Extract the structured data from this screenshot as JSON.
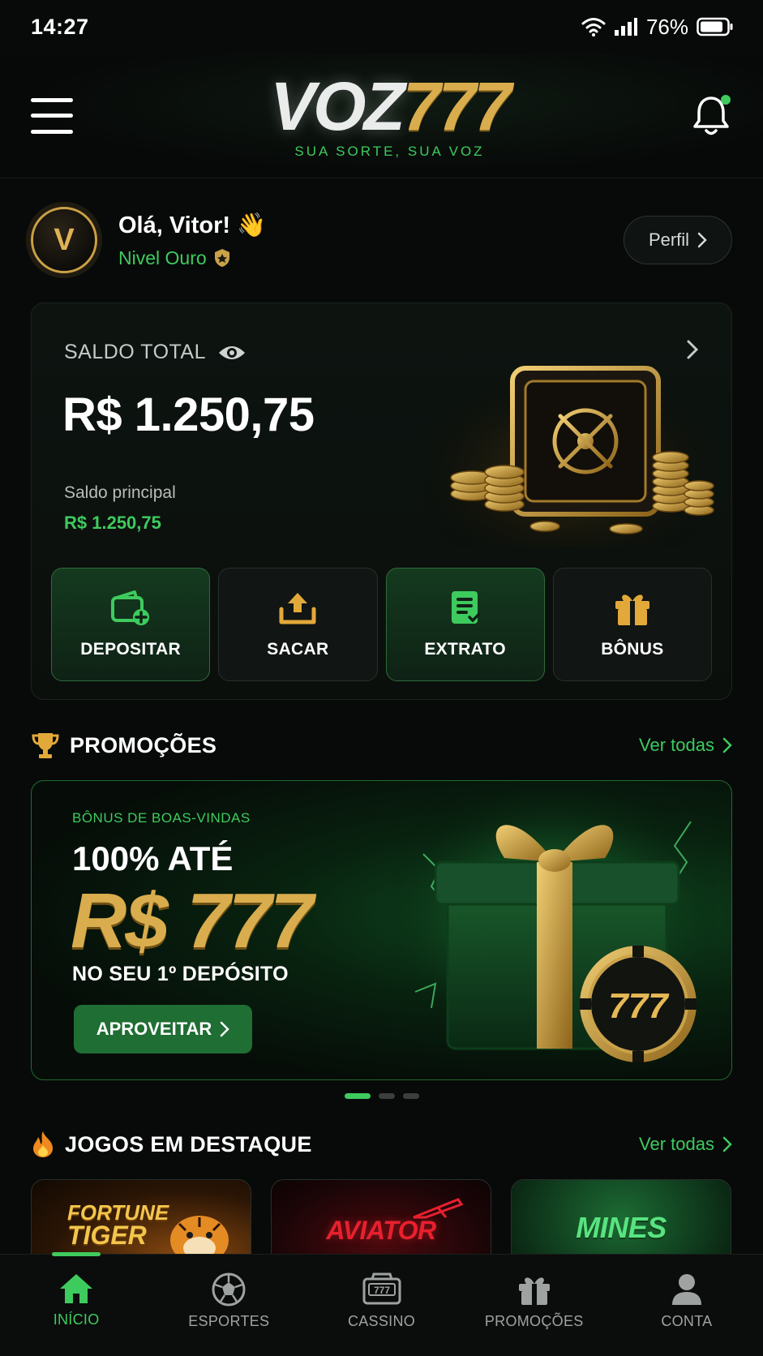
{
  "status_bar": {
    "time": "14:27",
    "battery": "76%"
  },
  "header": {
    "logo_left": "VOZ",
    "logo_right": "777",
    "tagline": "SUA SORTE, SUA VOZ"
  },
  "greeting": {
    "initial": "V",
    "hello": "Olá, Vitor! 👋",
    "level": "Nivel Ouro",
    "profile_button": "Perfil"
  },
  "balance": {
    "label": "SALDO TOTAL",
    "value": "R$ 1.250,75",
    "main_label": "Saldo principal",
    "main_value": "R$ 1.250,75",
    "actions": [
      {
        "label": "DEPOSITAR",
        "icon": "wallet-plus-icon"
      },
      {
        "label": "SACAR",
        "icon": "upload-tray-icon"
      },
      {
        "label": "EXTRATO",
        "icon": "receipt-icon"
      },
      {
        "label": "BÔNUS",
        "icon": "gift-icon"
      }
    ]
  },
  "promotions": {
    "title": "PROMOÇÕES",
    "see_all": "Ver todas",
    "banner": {
      "kicker": "BÔNUS DE BOAS-VINDAS",
      "line1": "100% ATÉ",
      "amount": "R$ 777",
      "line2": "NO SEU 1º DEPÓSITO",
      "cta": "APROVEITAR",
      "chip_text": "777"
    },
    "carousel_pages": 3,
    "active_page": 1
  },
  "featured_games": {
    "title": "JOGOS EM DESTAQUE",
    "see_all": "Ver todas",
    "games": [
      {
        "name": "FORTUNE TIGER",
        "line1": "FORTUNE",
        "line2": "TIGER"
      },
      {
        "name": "AVIATOR"
      },
      {
        "name": "MINES"
      }
    ]
  },
  "bottom_nav": [
    {
      "label": "INÍCIO",
      "icon": "home-icon",
      "active": true
    },
    {
      "label": "ESPORTES",
      "icon": "soccer-ball-icon",
      "active": false
    },
    {
      "label": "CASSINO",
      "icon": "slot-machine-icon",
      "active": false,
      "icon_text": "777"
    },
    {
      "label": "PROMOÇÕES",
      "icon": "gift-icon",
      "active": false
    },
    {
      "label": "CONTA",
      "icon": "user-icon",
      "active": false
    }
  ],
  "colors": {
    "accent_green": "#3ecb5e",
    "gold": "#d9ad4d",
    "background": "#080a09"
  }
}
